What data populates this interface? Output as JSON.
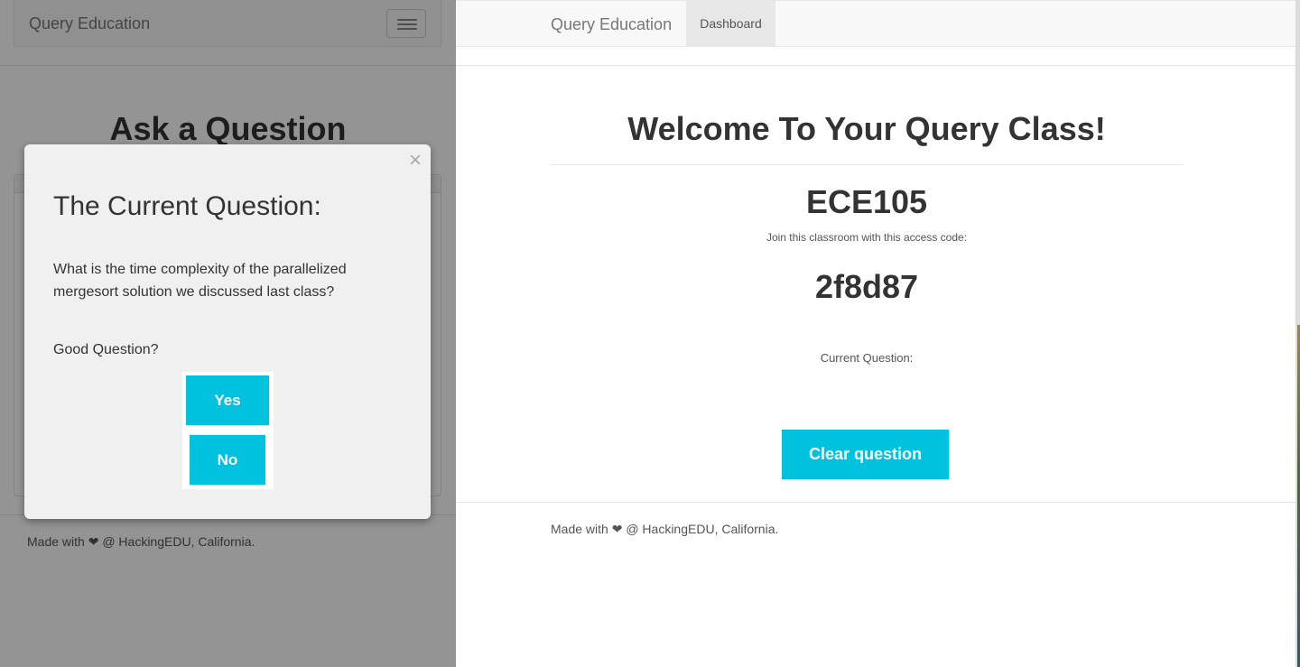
{
  "left_window": {
    "brand": "Query Education",
    "page_title": "Ask a Question",
    "footer": {
      "prefix": "Made with",
      "heart": "❤",
      "suffix": "@ HackingEDU, California."
    },
    "modal": {
      "close": "×",
      "title": "The Current Question:",
      "question": "What is the time complexity of the parallelized mergesort solution we discussed last class?",
      "prompt": "Good Question?",
      "yes_label": "Yes",
      "no_label": "No"
    }
  },
  "right_window": {
    "brand": "Query Education",
    "nav_tab": "Dashboard",
    "welcome": "Welcome To Your Query Class!",
    "class_name": "ECE105",
    "join_text": "Join this classroom with this access code:",
    "access_code": "2f8d87",
    "current_question_label": "Current Question:",
    "clear_button": "Clear question",
    "footer": {
      "prefix": "Made with",
      "heart": "❤",
      "suffix": "@ HackingEDU, California."
    }
  },
  "colors": {
    "accent": "#00c1de",
    "navbar_bg": "#f8f8f8",
    "modal_bg": "#f0f0f0"
  }
}
